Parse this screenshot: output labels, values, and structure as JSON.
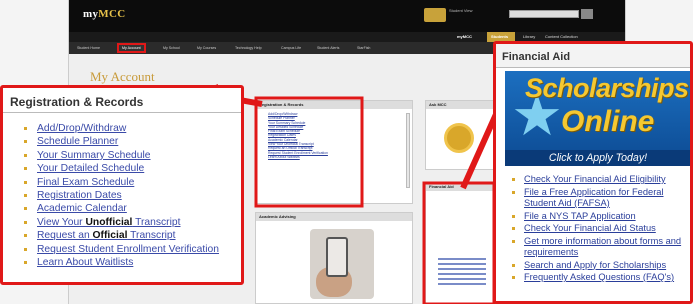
{
  "header": {
    "logo_prefix": "my",
    "logo_main": "MCC",
    "student_view_text": "Student View"
  },
  "links": {
    "mymcc": "myMCC",
    "students": "Students",
    "library": "Library",
    "content_collection": "Content Collection"
  },
  "nav": {
    "items": [
      "Student Home",
      "My Account",
      "My School",
      "My Courses",
      "Technology Help",
      "Campus Life",
      "Student Alerts",
      "StarFish"
    ]
  },
  "page_title": "My Account",
  "panels": {
    "registration_head": "Registration & Records",
    "ask_head": "Ask MCC",
    "financial_head": "Financial Aid",
    "learning_head": "Academic Advising"
  },
  "registration_callout": {
    "title": "Registration & Records",
    "items": [
      {
        "text": "Add/Drop/Withdraw"
      },
      {
        "text": "Schedule Planner"
      },
      {
        "text": "Your Summary Schedule"
      },
      {
        "text": "Your Detailed Schedule"
      },
      {
        "text": "Final Exam Schedule"
      },
      {
        "text": "Registration Dates"
      },
      {
        "text": "Academic Calendar"
      },
      {
        "pre": "View Your ",
        "bold": "Unofficial",
        "post": " Transcript"
      },
      {
        "pre": "Request an ",
        "bold": "Official",
        "post": " Transcript"
      },
      {
        "text": "Request Student Enrollment Verification"
      },
      {
        "text": "Learn About Waitlists"
      }
    ]
  },
  "financial_callout": {
    "title": "Financial Aid",
    "banner_line1": "Scholarships",
    "banner_line2": "Online",
    "banner_cta": "Click to Apply Today!",
    "items": [
      "Check Your Financial Aid Eligibility",
      "File a Free Application for Federal Student Aid (FAFSA)",
      "File a NYS TAP Application",
      "Check Your Financial Aid Status",
      "Get more information about forms and requirements",
      "Search and Apply for Scholarships",
      "Frequently Asked Questions (FAQ's)"
    ]
  },
  "colors": {
    "highlight": "#e01818",
    "link": "#3a4aa8",
    "accent_gold": "#d9a72a",
    "title_gold": "#c89b3a"
  },
  "icons": {
    "star": "star-icon",
    "phone": "phone-image"
  }
}
